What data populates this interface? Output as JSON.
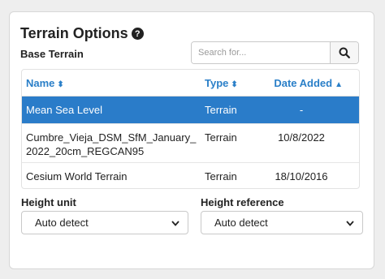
{
  "panel": {
    "title": "Terrain Options",
    "subtitle": "Base Terrain",
    "search_placeholder": "Search for..."
  },
  "table": {
    "headers": {
      "name": "Name",
      "type": "Type",
      "date": "Date Added"
    },
    "rows": [
      {
        "name": "Mean Sea Level",
        "type": "Terrain",
        "date": "-",
        "selected": true
      },
      {
        "name": "Cumbre_Vieja_DSM_SfM_January_2022_20cm_REGCAN95",
        "type": "Terrain",
        "date": "10/8/2022",
        "selected": false
      },
      {
        "name": "Cesium World Terrain",
        "type": "Terrain",
        "date": "18/10/2016",
        "selected": false
      }
    ]
  },
  "height_unit": {
    "label": "Height unit",
    "value": "Auto detect"
  },
  "height_reference": {
    "label": "Height reference",
    "value": "Auto detect"
  },
  "colors": {
    "accent": "#2a7cc9",
    "header_text": "#2a7fc8"
  }
}
